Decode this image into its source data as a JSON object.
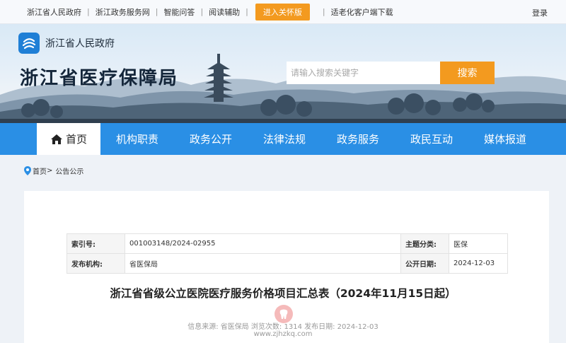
{
  "topbar": {
    "links": [
      "浙江省人民政府",
      "浙江政务服务网",
      "智能问答",
      "阅读辅助"
    ],
    "care_button": "进入关怀版",
    "app_link": "适老化客户端下载",
    "login": "登录"
  },
  "header": {
    "gov_name": "浙江省人民政府",
    "site_title": "浙江省医疗保障局",
    "logo_icon": "zhejiang-gov-logo-icon",
    "search": {
      "placeholder": "请输入搜索关键字",
      "button": "搜索"
    }
  },
  "nav": {
    "items": [
      {
        "label": "首页",
        "active": true
      },
      {
        "label": "机构职责"
      },
      {
        "label": "政务公开"
      },
      {
        "label": "法律法规"
      },
      {
        "label": "政务服务"
      },
      {
        "label": "政民互动"
      },
      {
        "label": "媒体报道"
      }
    ]
  },
  "breadcrumb": {
    "home": "首页",
    "sep": ">",
    "current": "公告公示"
  },
  "meta": {
    "index_label": "索引号:",
    "index_value": "001003148/2024-02955",
    "topic_label": "主题分类:",
    "topic_value": "医保",
    "issuer_label": "发布机构:",
    "issuer_value": "省医保局",
    "date_label": "公开日期:",
    "date_value": "2024-12-03"
  },
  "article": {
    "title": "浙江省省级公立医院医疗服务价格项目汇总表（2024年11月15日起）",
    "info": "信息来源:  省医保局  浏览次数:  1314  发布日期:  2024-12-03"
  },
  "watermark": {
    "text": "www.zjhzkq.com"
  },
  "colors": {
    "nav": "#2a8fe5",
    "accent": "#f39a1f"
  }
}
